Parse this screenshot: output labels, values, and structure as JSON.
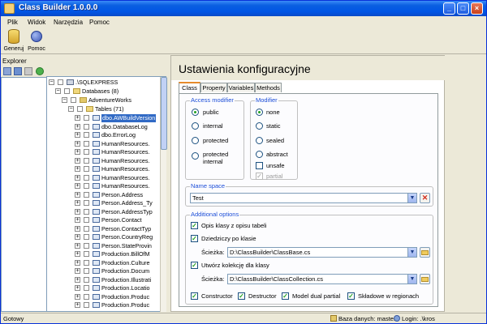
{
  "window": {
    "title": "Class Builder 1.0.0.0",
    "min_label": "_",
    "max_label": "□",
    "close_label": "×"
  },
  "menu": {
    "items": [
      "Plik",
      "Widok",
      "Narzędzia",
      "Pomoc"
    ]
  },
  "toolbar": {
    "generate_label": "Generuj",
    "help_label": "Pomoc"
  },
  "explorer": {
    "title": "Explorer",
    "tree": {
      "server": ".\\SQLEXPRESS",
      "databases": "Databases (8)",
      "database": "AdventureWorks",
      "tables_node": "Tables (71)",
      "tables": [
        "dbo.AWBuildVersion",
        "dbo.DatabaseLog",
        "dbo.ErrorLog",
        "HumanResources.",
        "HumanResources.",
        "HumanResources.",
        "HumanResources.",
        "HumanResources.",
        "HumanResources.",
        "Person.Address",
        "Person.Address_Ty",
        "Person.AddressTyp",
        "Person.Contact",
        "Person.ContactTyp",
        "Person.CountryReg",
        "Person.StateProvin",
        "Production.BillOfM",
        "Production.Culture",
        "Production.Docum",
        "Production.Illustrati",
        "Production.Locatio",
        "Production.Produc",
        "Production.Produc"
      ]
    }
  },
  "config": {
    "title": "Ustawienia konfiguracyjne",
    "tabs": [
      "Class",
      "Property",
      "Variables",
      "Methods"
    ],
    "access_modifier": {
      "label": "Access modifier",
      "options": [
        "public",
        "internal",
        "protected",
        "protected internal"
      ],
      "selected": "public"
    },
    "modifier": {
      "label": "Modifier",
      "options": [
        "none",
        "static",
        "sealed",
        "abstract"
      ],
      "selected": "none",
      "unsafe_label": "unsafe",
      "partial_label": "partial"
    },
    "namespace": {
      "label": "Name space",
      "value": "Test"
    },
    "additional": {
      "label": "Additional options",
      "opis_klasy": "Opis klasy z opisu tabeli",
      "dziedziczy": "Dziedziczy po klasie",
      "path_label": "Ścieżka:",
      "base_path": "D:\\ClassBuilder\\ClassBase.cs",
      "create_collection": "Utwórz kolekcję dla klasy",
      "collection_path": "D:\\ClassBuilder\\ClassCollection.cs",
      "constructor": "Constructor",
      "destructor": "Destructor",
      "dual_partial": "Model dual partial",
      "regions": "Składowe w regionach"
    }
  },
  "status": {
    "left": "Gotowy",
    "db": "Baza danych: master",
    "login": "Login: .\\kros"
  },
  "colors": {
    "titlebar": "#0055e5",
    "selection": "#316ac5",
    "group_label": "#1c4ed8"
  }
}
